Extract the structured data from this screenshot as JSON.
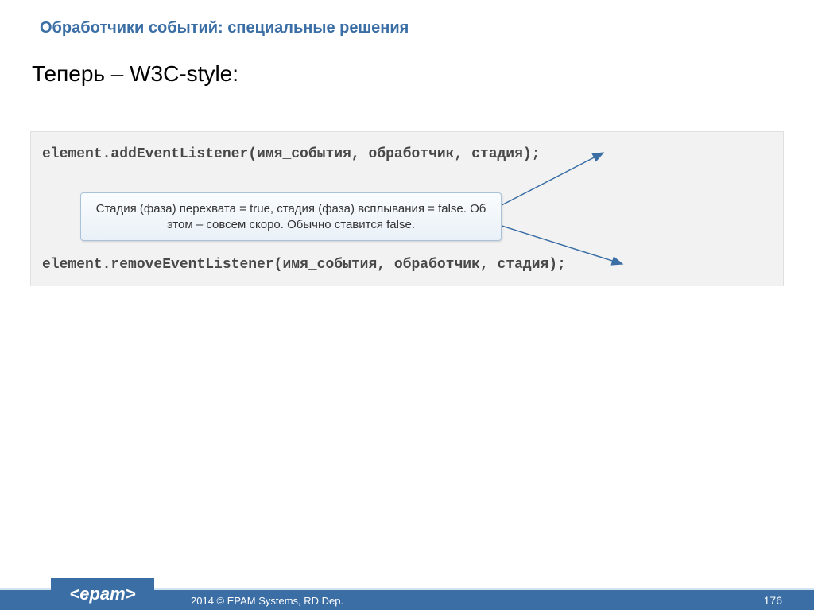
{
  "header": "Обработчики событий: специальные решения",
  "subtitle": "Теперь – W3C-style:",
  "code": {
    "line1": "element.addEventListener(имя_события, обработчик, стадия);",
    "line2": "element.removeEventListener(имя_события, обработчик, стадия);"
  },
  "callout": "Стадия (фаза) перехвата = true, стадия (фаза) всплывания = false. Об этом – совсем скоро. Обычно ставится false.",
  "footer": {
    "logo": "<epam>",
    "copyright": "2014 © EPAM Systems, RD Dep.",
    "page": "176"
  }
}
